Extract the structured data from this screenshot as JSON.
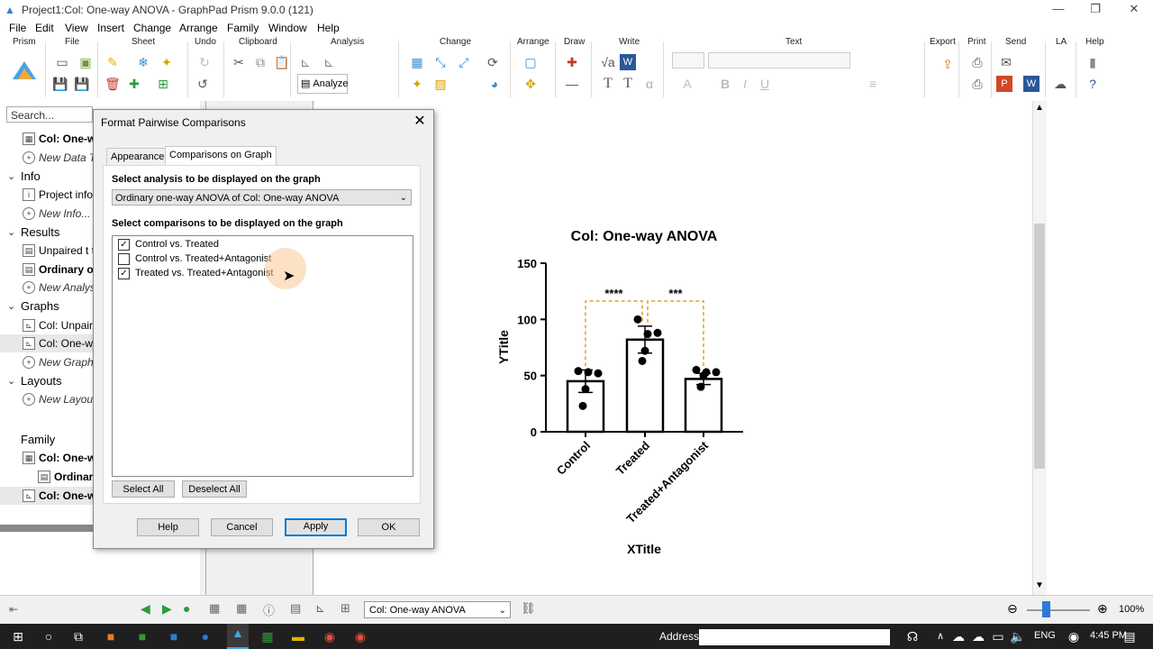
{
  "window": {
    "title": "Project1:Col: One-way ANOVA - GraphPad Prism 9.0.0 (121)"
  },
  "menu": [
    "File",
    "Edit",
    "View",
    "Insert",
    "Change",
    "Arrange",
    "Family",
    "Window",
    "Help"
  ],
  "ribbon": {
    "groups": [
      "Prism",
      "File",
      "Sheet",
      "Undo",
      "Clipboard",
      "Analysis",
      "Change",
      "Arrange",
      "Draw",
      "Write",
      "Text",
      "Export",
      "Print",
      "Send",
      "LA",
      "Help"
    ],
    "analyze_label": "Analyze"
  },
  "navigator": {
    "search_placeholder": "Search...",
    "rows": [
      {
        "kind": "item",
        "label": "Col: One-wa",
        "bold": true,
        "icon": "table-icon"
      },
      {
        "kind": "new",
        "label": "New Data T"
      },
      {
        "kind": "header",
        "label": "Info"
      },
      {
        "kind": "item",
        "label": "Project info",
        "icon": "info-icon"
      },
      {
        "kind": "new",
        "label": "New Info..."
      },
      {
        "kind": "header",
        "label": "Results"
      },
      {
        "kind": "item",
        "label": "Unpaired t te",
        "icon": "results-icon"
      },
      {
        "kind": "item",
        "label": "Ordinary on",
        "bold": true,
        "icon": "results-icon"
      },
      {
        "kind": "new",
        "label": "New Analysi"
      },
      {
        "kind": "header",
        "label": "Graphs"
      },
      {
        "kind": "item",
        "label": "Col: Unpaire",
        "icon": "graph-icon"
      },
      {
        "kind": "item",
        "label": "Col: One-wa",
        "icon": "graph-icon",
        "selected": true
      },
      {
        "kind": "new",
        "label": "New Graph..."
      },
      {
        "kind": "header",
        "label": "Layouts"
      },
      {
        "kind": "new",
        "label": "New Layout"
      }
    ],
    "family_label": "Family",
    "family_rows": [
      {
        "label": "Col: One-wa",
        "bold": true,
        "icon": "table-icon",
        "indent": 0
      },
      {
        "label": "Ordinary",
        "bold": true,
        "icon": "results-icon",
        "indent": 1
      },
      {
        "label": "Col: One-wa",
        "bold": true,
        "icon": "graph-icon",
        "indent": 0,
        "selected": true
      }
    ]
  },
  "dialog": {
    "title": "Format Pairwise Comparisons",
    "tabs": [
      {
        "label": "Appearance",
        "active": false
      },
      {
        "label": "Comparisons on Graph",
        "active": true
      }
    ],
    "analysis_heading": "Select analysis to be displayed on the graph",
    "analysis_value": "Ordinary one-way ANOVA of Col: One-way ANOVA",
    "comparisons_heading": "Select comparisons to be displayed on the graph",
    "comparisons": [
      {
        "label": "Control vs. Treated",
        "checked": true
      },
      {
        "label": "Control vs. Treated+Antagonist",
        "checked": false
      },
      {
        "label": "Treated vs. Treated+Antagonist",
        "checked": true
      }
    ],
    "select_all": "Select All",
    "deselect_all": "Deselect All",
    "buttons": {
      "help": "Help",
      "cancel": "Cancel",
      "apply": "Apply",
      "ok": "OK"
    }
  },
  "chart_data": {
    "type": "bar",
    "title": "Col: One-way ANOVA",
    "xlabel": "XTitle",
    "ylabel": "YTitle",
    "ylim": [
      0,
      150
    ],
    "yticks": [
      0,
      50,
      100,
      150
    ],
    "categories": [
      "Control",
      "Treated",
      "Treated+Antagonist"
    ],
    "values": [
      45,
      82,
      47
    ],
    "error": [
      10,
      12,
      5
    ],
    "points": [
      [
        54,
        53,
        52,
        38,
        23
      ],
      [
        100,
        87,
        88,
        72,
        63
      ],
      [
        55,
        53,
        53,
        50,
        40
      ]
    ],
    "significance": [
      {
        "from": 0,
        "to": 1,
        "label": "****"
      },
      {
        "from": 1,
        "to": 2,
        "label": "***"
      }
    ],
    "bracket_color": "#e0a030"
  },
  "statusbar": {
    "sheet_value": "Col: One-way ANOVA",
    "zoom": "100%"
  },
  "taskbar": {
    "address_label": "Address",
    "lang": "ENG",
    "time": "4:45 PM"
  }
}
